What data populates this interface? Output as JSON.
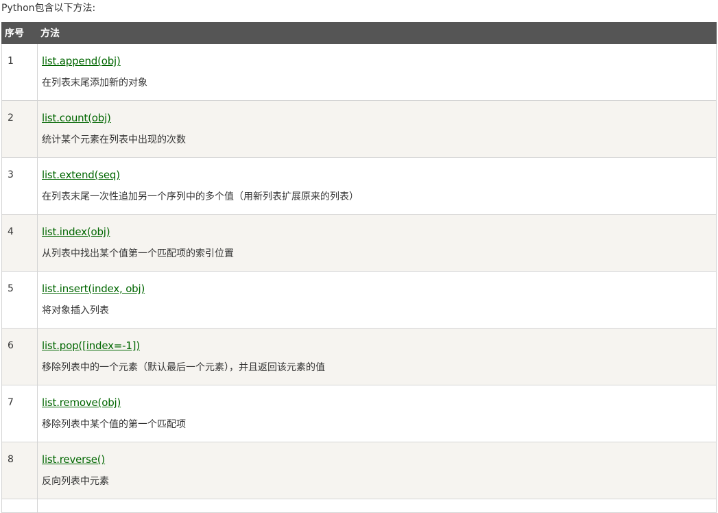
{
  "intro": "Python包含以下方法:",
  "table": {
    "headers": {
      "num": "序号",
      "method": "方法"
    },
    "rows": [
      {
        "num": "1",
        "method": "list.append(obj)",
        "desc": "在列表末尾添加新的对象"
      },
      {
        "num": "2",
        "method": "list.count(obj)",
        "desc": "统计某个元素在列表中出现的次数"
      },
      {
        "num": "3",
        "method": "list.extend(seq)",
        "desc": "在列表末尾一次性追加另一个序列中的多个值（用新列表扩展原来的列表）"
      },
      {
        "num": "4",
        "method": "list.index(obj)",
        "desc": "从列表中找出某个值第一个匹配项的索引位置"
      },
      {
        "num": "5",
        "method": "list.insert(index, obj)",
        "desc": "将对象插入列表"
      },
      {
        "num": "6",
        "method": "list.pop([index=-1])",
        "desc": "移除列表中的一个元素（默认最后一个元素），并且返回该元素的值"
      },
      {
        "num": "7",
        "method": "list.remove(obj)",
        "desc": "移除列表中某个值的第一个匹配项"
      },
      {
        "num": "8",
        "method": "list.reverse()",
        "desc": "反向列表中元素"
      }
    ]
  },
  "colors": {
    "header_bg": "#555555",
    "link": "#006600",
    "row_alt_bg": "#f6f4f0"
  }
}
